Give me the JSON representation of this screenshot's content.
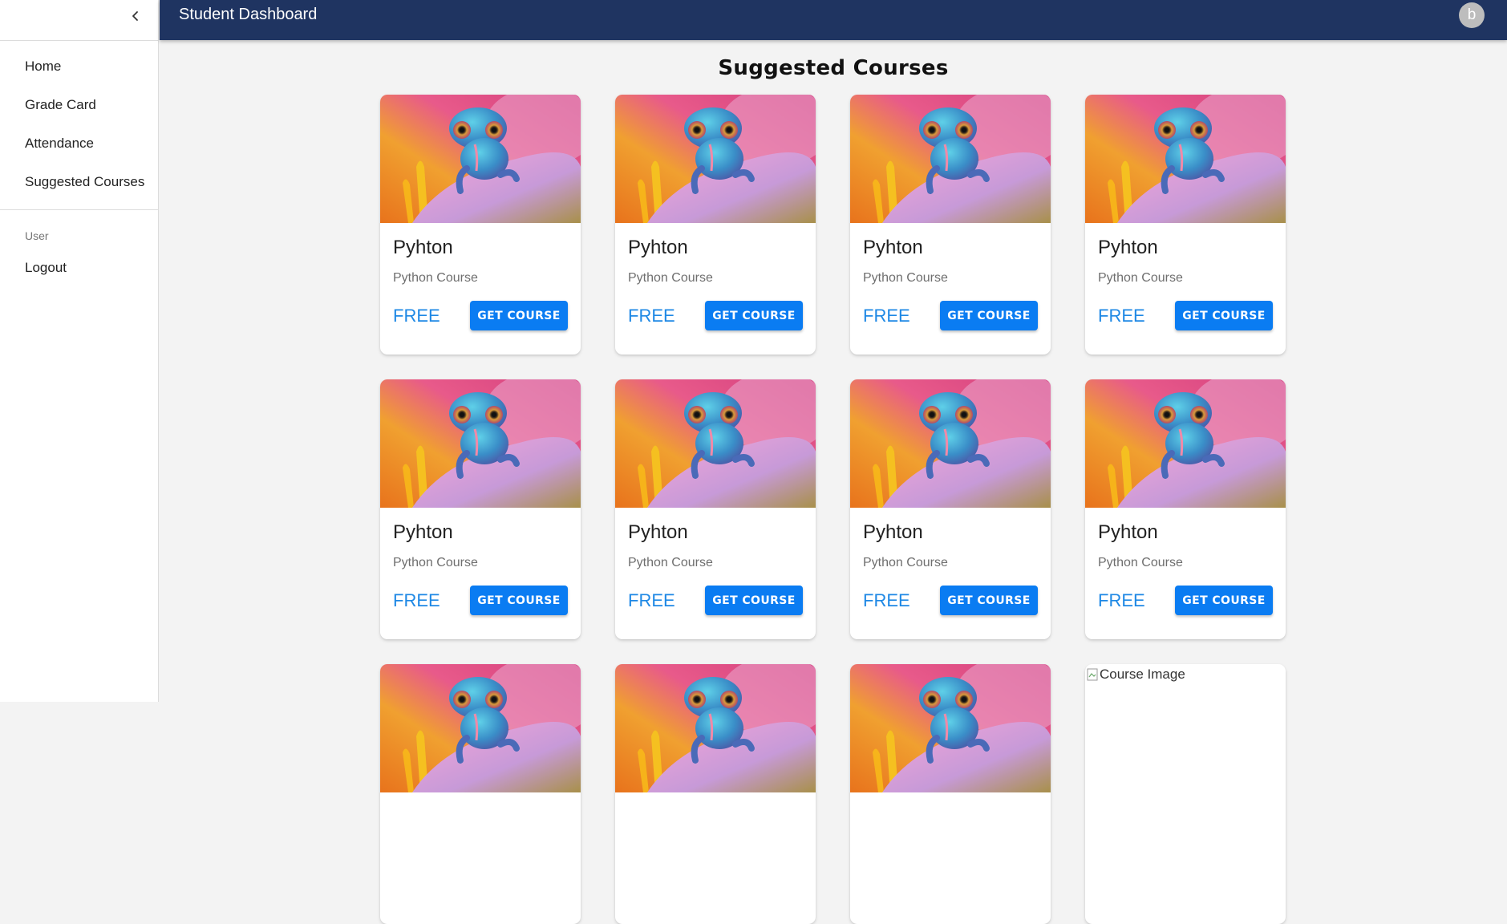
{
  "app": {
    "title": "Student Dashboard",
    "avatar_letter": "b"
  },
  "sidebar": {
    "items": [
      {
        "label": "Home"
      },
      {
        "label": "Grade Card"
      },
      {
        "label": "Attendance"
      },
      {
        "label": "Suggested Courses"
      }
    ],
    "section_label": "User",
    "logout_label": "Logout"
  },
  "main": {
    "title": "Suggested Courses",
    "courses": [
      {
        "title": "Pyhton",
        "description": "Python Course",
        "price": "FREE",
        "button": "GET COURSE"
      },
      {
        "title": "Pyhton",
        "description": "Python Course",
        "price": "FREE",
        "button": "GET COURSE"
      },
      {
        "title": "Pyhton",
        "description": "Python Course",
        "price": "FREE",
        "button": "GET COURSE"
      },
      {
        "title": "Pyhton",
        "description": "Python Course",
        "price": "FREE",
        "button": "GET COURSE"
      },
      {
        "title": "Pyhton",
        "description": "Python Course",
        "price": "FREE",
        "button": "GET COURSE"
      },
      {
        "title": "Pyhton",
        "description": "Python Course",
        "price": "FREE",
        "button": "GET COURSE"
      },
      {
        "title": "Pyhton",
        "description": "Python Course",
        "price": "FREE",
        "button": "GET COURSE"
      },
      {
        "title": "Pyhton",
        "description": "Python Course",
        "price": "FREE",
        "button": "GET COURSE"
      }
    ],
    "broken_image_alt": "Course Image"
  },
  "colors": {
    "appbar": "#1f3461",
    "button": "#0a7cf2",
    "price": "#1e88e5"
  },
  "icons": {
    "collapse": "chevron-left-icon",
    "course_image": "chameleon-image"
  }
}
